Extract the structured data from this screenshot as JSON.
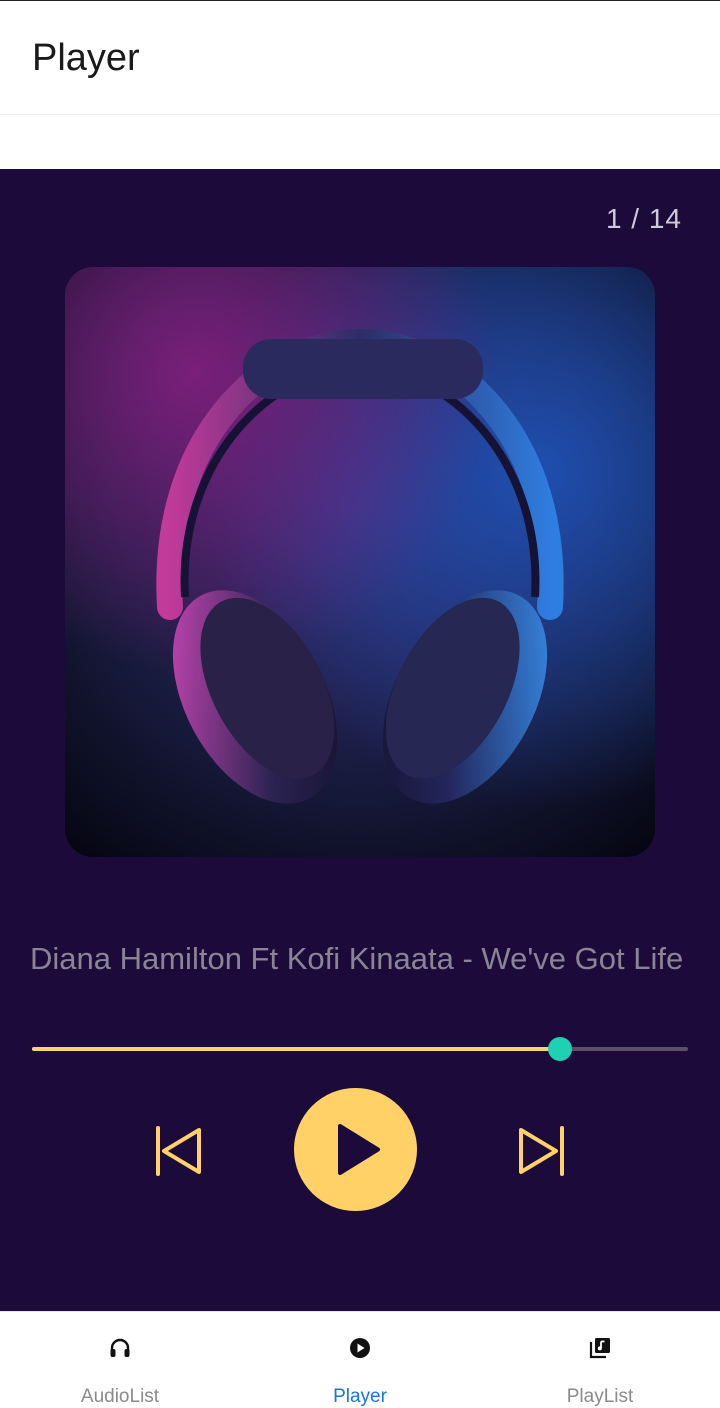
{
  "header": {
    "title": "Player"
  },
  "player": {
    "counter": "1 / 14",
    "track_title": "Diana Hamilton Ft Kofi Kinaata - We've Got Life",
    "progress_fraction": 0.805,
    "colors": {
      "background": "#1c0b3a",
      "accent": "#ffd166",
      "thumb": "#1fd1b2"
    },
    "artwork_icon": "headphones-artwork",
    "controls": {
      "prev_icon": "skip-previous-icon",
      "play_icon": "play-icon",
      "next_icon": "skip-next-icon"
    }
  },
  "bottom_nav": {
    "items": [
      {
        "label": "AudioList",
        "icon": "headphones-icon",
        "active": false
      },
      {
        "label": "Player",
        "icon": "play-circle-icon",
        "active": true
      },
      {
        "label": "PlayList",
        "icon": "music-library-icon",
        "active": false
      }
    ],
    "active_color": "#1a73e8"
  }
}
